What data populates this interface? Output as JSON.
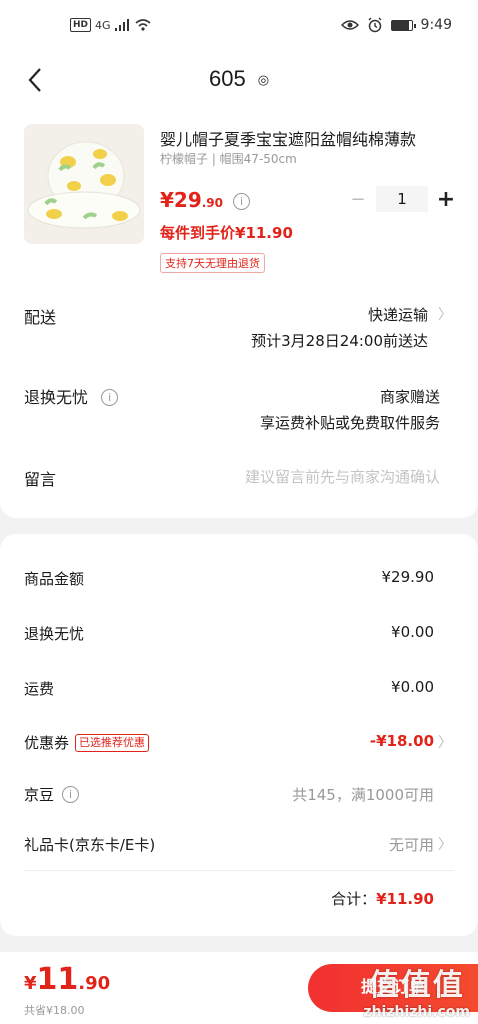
{
  "status": {
    "network": "4G",
    "hd": "HD",
    "time": "9:49"
  },
  "nav": {
    "title": "605"
  },
  "product": {
    "title": "婴儿帽子夏季宝宝遮阳盆帽纯棉薄款",
    "spec": "柠檬帽子 | 帽围47-50cm",
    "price_int": "¥29",
    "price_dec": ".90",
    "unit_price": "每件到手价¥11.90",
    "tag": "支持7天无理由退货",
    "quantity": "1"
  },
  "rows": {
    "delivery_label": "配送",
    "delivery_value": "快递运输",
    "delivery_eta": "预计3月28日24:00前送达",
    "return_label": "退换无忧",
    "return_value": "商家赠送",
    "return_desc": "享运费补贴或免费取件服务",
    "message_label": "留言",
    "message_placeholder": "建议留言前先与商家沟通确认"
  },
  "summary": {
    "goods_label": "商品金额",
    "goods_value": "¥29.90",
    "return_label": "退换无忧",
    "return_value": "¥0.00",
    "freight_label": "运费",
    "freight_value": "¥0.00",
    "coupon_label": "优惠券",
    "coupon_tag": "已选推荐优惠",
    "coupon_value": "-¥18.00",
    "jingdou_label": "京豆",
    "jingdou_value": "共145，满1000可用",
    "giftcard_label": "礼品卡(京东卡/E卡)",
    "giftcard_value": "无可用",
    "total_label": "合计：",
    "total_value": "¥11.90"
  },
  "footer": {
    "price_yen": "¥",
    "price_int": "11",
    "price_dec": ".90",
    "saved": "共省¥18.00",
    "submit_label": "提交订单"
  },
  "watermark": {
    "glyphs": "值值值",
    "site": "zhizhizhi.com"
  }
}
